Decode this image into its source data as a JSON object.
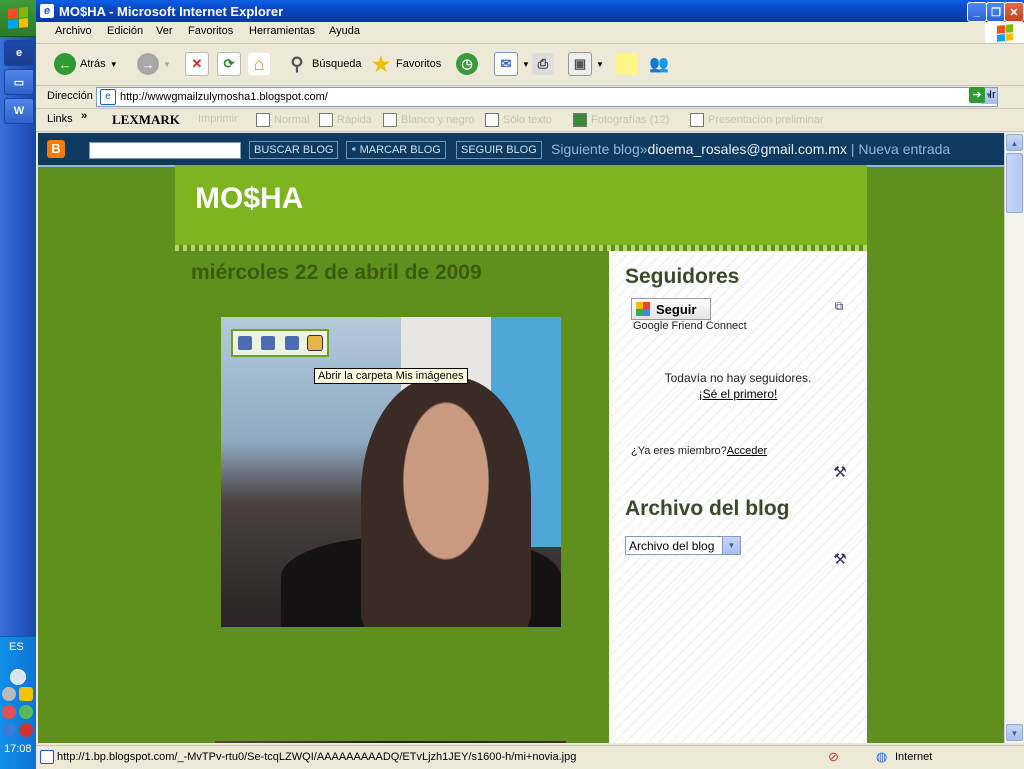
{
  "window": {
    "title": "MO$HA - Microsoft Internet Explorer"
  },
  "menubar": {
    "items": [
      "Archivo",
      "Edición",
      "Ver",
      "Favoritos",
      "Herramientas",
      "Ayuda"
    ]
  },
  "toolbar": {
    "back_label": "Atrás",
    "search_label": "Búsqueda",
    "favorites_label": "Favoritos"
  },
  "addressbar": {
    "label": "Dirección",
    "url": "http://wwwgmailzulymosha1.blogspot.com/",
    "go_label": "Ir"
  },
  "linksbar": {
    "label": "Links",
    "brand": "LEXMARK",
    "items": [
      "Imprimir",
      "Normal",
      "Rápida",
      "Blanco y negro",
      "Sólo texto",
      "Fotografías (12)",
      "Presentación preliminar"
    ]
  },
  "navbar": {
    "buscar": "BUSCAR BLOG",
    "marcar": "MARCAR BLOG",
    "seguir": "SEGUIR BLOG",
    "siguiente": "Siguiente blog»",
    "email": "dioema_rosales@gmail.com.mx",
    "separator": "|",
    "nueva": "Nueva entrada"
  },
  "blog": {
    "title": "MO$HA",
    "date": "miércoles 22 de abril de 2009",
    "tooltip": "Abrir la carpeta Mis imágenes"
  },
  "sidebar": {
    "followers_title": "Seguidores",
    "follow_button": "Seguir",
    "gfc": "Google Friend Connect",
    "no_followers": "Todavía no hay seguidores.",
    "be_first": "¡Sé el primero!",
    "member_q": "¿Ya eres miembro?",
    "login": "Acceder",
    "archive_title": "Archivo del blog",
    "archive_select": "Archivo del blog"
  },
  "statusbar": {
    "url": "http://1.bp.blogspot.com/_-MvTPv-rtu0/Se-tcqLZWQI/AAAAAAAAADQ/ETvLjzh1JEY/s1600-h/mi+novia.jpg",
    "zone": "Internet"
  },
  "taskbar": {
    "lang": "ES",
    "time": "17:08"
  },
  "colors": {
    "page_bg": "#5f8f1d",
    "header_bg": "#7db41f",
    "navbar_bg": "#0f3a60"
  }
}
